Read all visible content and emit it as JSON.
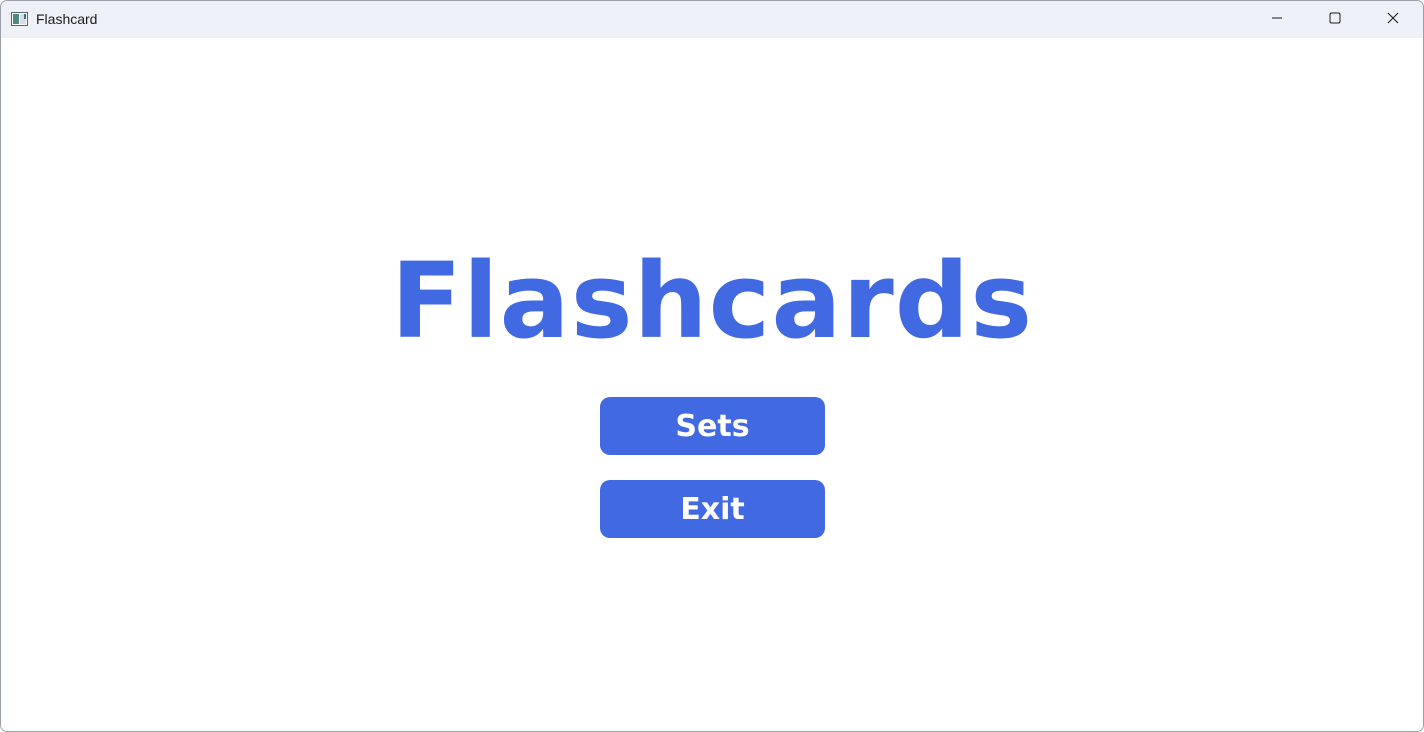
{
  "window": {
    "title": "Flashcard",
    "icon": "app-window-icon",
    "controls": {
      "minimize_icon": "minimize-icon",
      "maximize_icon": "maximize-icon",
      "close_icon": "close-icon"
    }
  },
  "main": {
    "heading": "Flashcards",
    "buttons": {
      "sets_label": "Sets",
      "exit_label": "Exit"
    }
  },
  "colors": {
    "accent": "#4169e1",
    "titlebar": "#eef2f8",
    "background": "#ffffff",
    "button_text": "#ffffff"
  }
}
